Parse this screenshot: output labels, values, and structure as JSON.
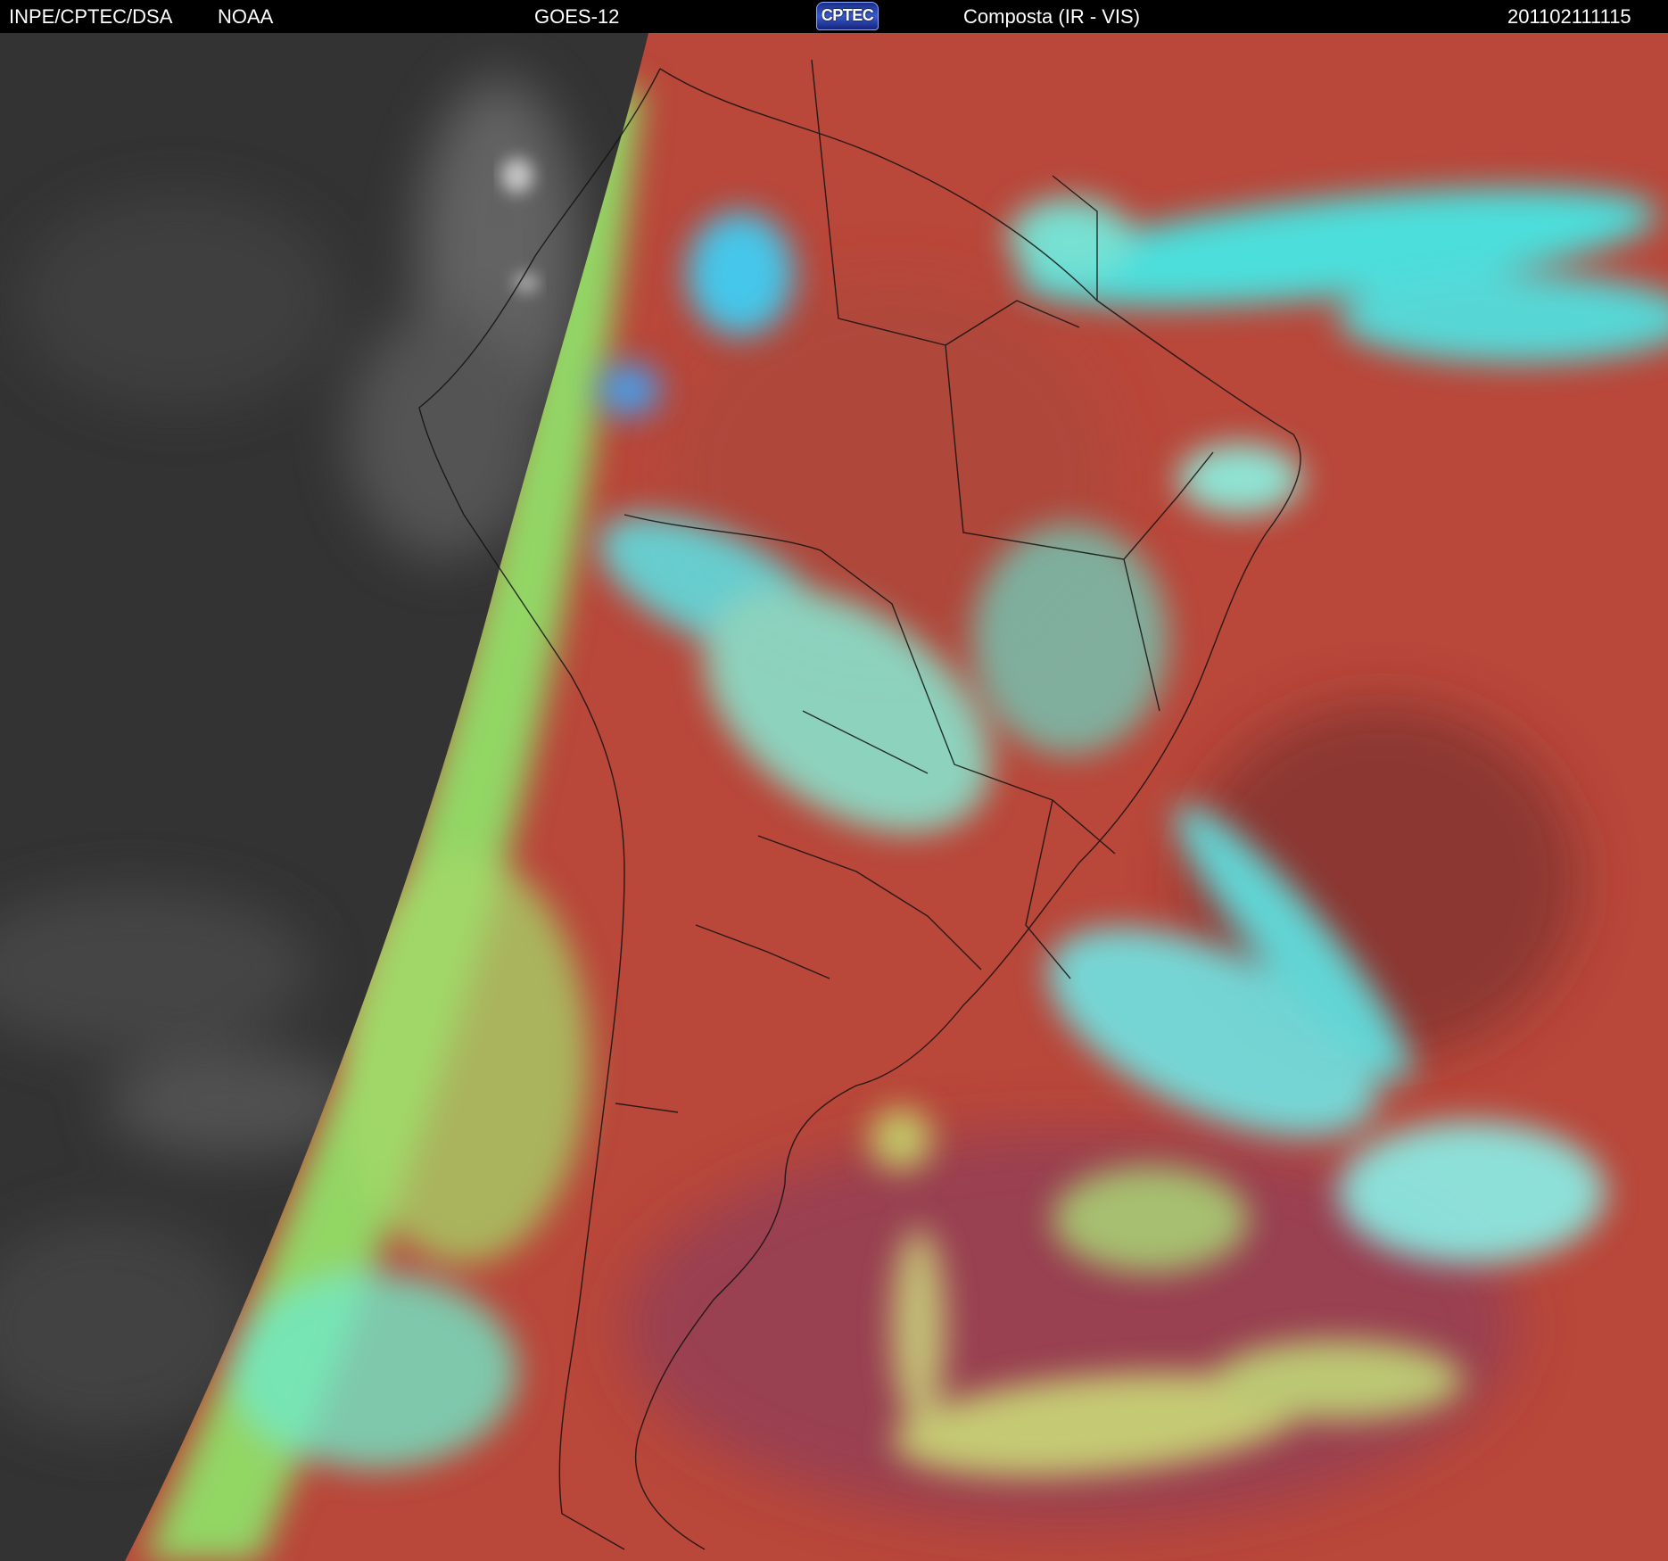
{
  "header": {
    "organization": "INPE/CPTEC/DSA",
    "agency": "NOAA",
    "satellite": "GOES-12",
    "logo_text": "CPTEC",
    "product": "Composta (IR - VIS)",
    "timestamp": "201102111115"
  },
  "colors": {
    "night_side": "#3a3a3a",
    "land_clear": "#b04a3c",
    "ocean_clear": "#c0463a",
    "high_cloud": "#40f0f0",
    "mid_cloud": "#8ee070",
    "low_cloud": "#c8e070",
    "borders": "#111111"
  }
}
